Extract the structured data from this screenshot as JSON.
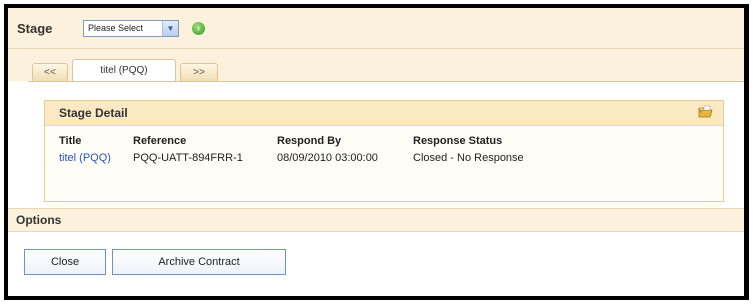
{
  "stage": {
    "label": "Stage",
    "select_value": "Please Select",
    "arrow_glyph": "▼",
    "go_icon": "go-arrow-icon",
    "go_glyph": "›"
  },
  "tabs": [
    {
      "label": "<<"
    },
    {
      "label": "titel (PQQ)"
    },
    {
      "label": ">>"
    }
  ],
  "stage_detail": {
    "title": "Stage Detail",
    "icon": "folder-open-icon",
    "columns": [
      {
        "header": "Title",
        "value": "titel (PQQ)"
      },
      {
        "header": "Reference",
        "value": "PQQ-UATT-894FRR-1"
      },
      {
        "header": "Respond By",
        "value": "08/09/2010 03:00:00"
      },
      {
        "header": "Response Status",
        "value": "Closed - No Response"
      }
    ]
  },
  "options": {
    "label": "Options",
    "buttons": [
      {
        "label": "Close"
      },
      {
        "label": "Archive Contract"
      }
    ]
  },
  "colors": {
    "accent_bg": "#fcf1dc",
    "link": "#2a57b3",
    "button_border": "#6e93c7"
  }
}
